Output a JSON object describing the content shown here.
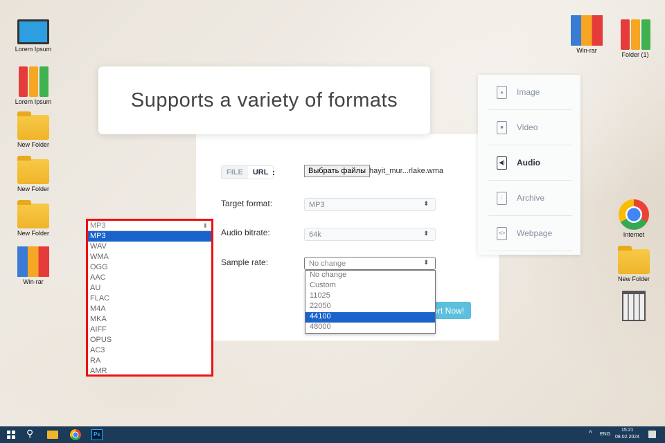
{
  "desktop": {
    "left_icons": [
      "Lorem Ipsum",
      "Lorem Ipsum",
      "New Folder",
      "New Folder",
      "New Folder",
      "Win-rar"
    ],
    "right_icons": [
      "Win-rar",
      "Folder (1)",
      "Internet",
      "New Folder"
    ]
  },
  "banner": {
    "title": "Supports a variety of formats"
  },
  "form": {
    "tab_file": "FILE",
    "tab_url": "URL",
    "colon": ":",
    "choose_button": "Выбрать файлы",
    "file_name": "hayit_mur...rlake.wma",
    "target_format_label": "Target format:",
    "target_format_value": "MP3",
    "bitrate_label": "Audio bitrate:",
    "bitrate_value": "64k",
    "sample_rate_label": "Sample rate:",
    "sample_rate_value": "No change",
    "sample_rate_options": [
      "No change",
      "Custom",
      "11025",
      "22050",
      "44100",
      "48000"
    ],
    "sample_rate_highlighted": "44100",
    "convert_button": "Convert Now!"
  },
  "menu": {
    "items": [
      "Image",
      "Video",
      "Audio",
      "Archive",
      "Webpage"
    ],
    "active": "Audio"
  },
  "format_dropdown": {
    "value": "MP3",
    "options": [
      "MP3",
      "WAV",
      "WMA",
      "OGG",
      "AAC",
      "AU",
      "FLAC",
      "M4A",
      "MKA",
      "AIFF",
      "OPUS",
      "AC3",
      "RA",
      "AMR"
    ],
    "highlighted": "MP3"
  },
  "taskbar": {
    "lang": "ENG",
    "time": "15:21",
    "date": "08.02.2024"
  }
}
